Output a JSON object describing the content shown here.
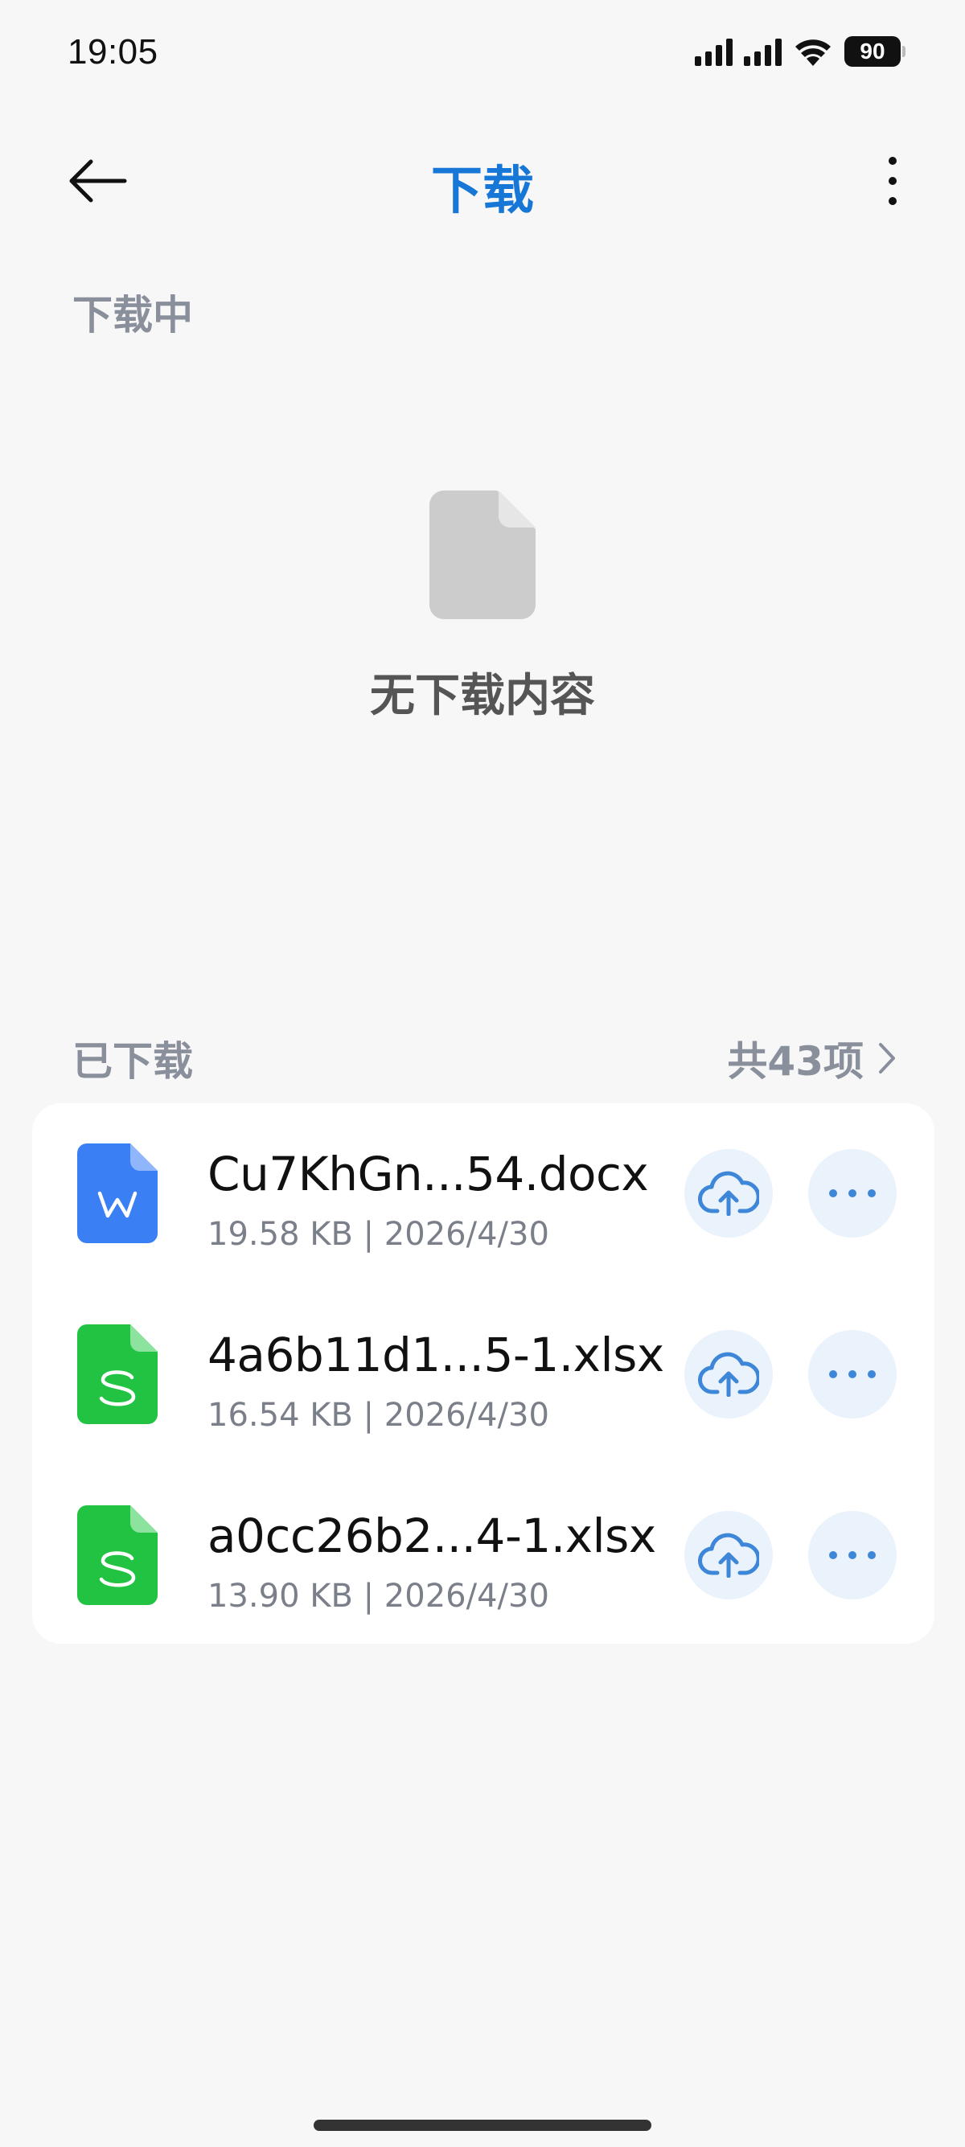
{
  "status_bar": {
    "time": "19:05",
    "battery": "90",
    "icons": [
      "signal-icon",
      "signal-icon",
      "wifi-icon",
      "battery-icon"
    ]
  },
  "header": {
    "title": "下载",
    "back_icon": "back-arrow-icon",
    "more_icon": "more-vertical-icon"
  },
  "downloading": {
    "label": "下载中",
    "empty_icon": "document-icon",
    "empty_text": "无下载内容"
  },
  "downloaded": {
    "label": "已下载",
    "count_label": "共43项",
    "files": [
      {
        "name": "Cu7KhGn...54.docx",
        "meta": "19.58 KB | 2026/4/30",
        "type": "docx",
        "icon_letter": "W",
        "icon_color": "#3b7ff5"
      },
      {
        "name": "4a6b11d1...5-1.xlsx",
        "meta": "16.54 KB | 2026/4/30",
        "type": "xlsx",
        "icon_letter": "S",
        "icon_color": "#22c342"
      },
      {
        "name": "a0cc26b2...4-1.xlsx",
        "meta": "13.90 KB | 2026/4/30",
        "type": "xlsx",
        "icon_letter": "S",
        "icon_color": "#22c342"
      }
    ]
  },
  "colors": {
    "accent": "#1677d6",
    "label_gray": "#8a8f9c",
    "button_bg": "#eaf2fc",
    "button_icon": "#3d86d8"
  }
}
